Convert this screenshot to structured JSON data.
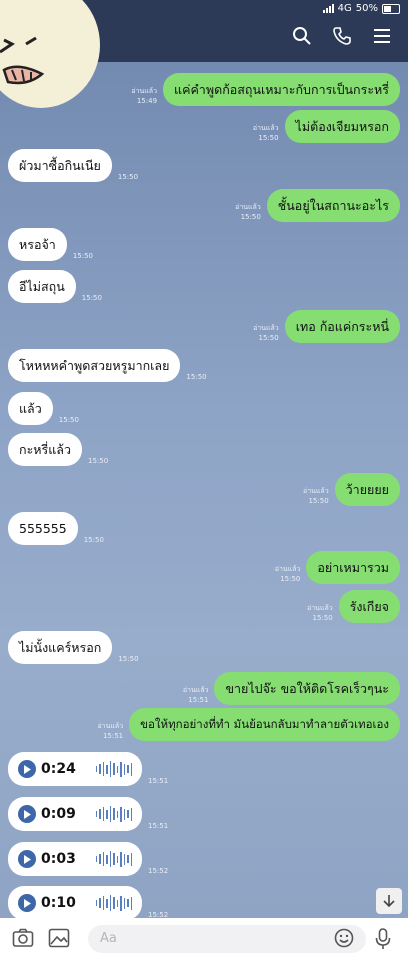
{
  "status": {
    "network": "4G",
    "battery": "50%"
  },
  "messages": [
    {
      "side": "me",
      "text": "แค่คำพูดก้อสถุนเหมาะกับการเป็นกระหรี่",
      "read": "อ่านแล้ว",
      "time": "15:49"
    },
    {
      "side": "me",
      "text": "ไม่ต้องเจียมหรอก",
      "read": "อ่านแล้ว",
      "time": "15:50"
    },
    {
      "side": "them",
      "text": "ผัวมาซื้อกินเนีย",
      "time": "15:50"
    },
    {
      "side": "me",
      "text": "ชั้นอยู่ในสถานะอะไร",
      "read": "อ่านแล้ว",
      "time": "15:50"
    },
    {
      "side": "them",
      "text": "หรอจ้า",
      "time": "15:50"
    },
    {
      "side": "them",
      "text": "อีไม่สถุน",
      "time": "15:50"
    },
    {
      "side": "me",
      "text": "เทอ ก้อแค่กระหนี่",
      "read": "อ่านแล้ว",
      "time": "15:50"
    },
    {
      "side": "them",
      "text": "โหหหหคำพูดสวยหรูมากเลย",
      "time": "15:50"
    },
    {
      "side": "them",
      "text": "แล้ว",
      "time": "15:50"
    },
    {
      "side": "them",
      "text": "กะหรี่แล้ว",
      "time": "15:50"
    },
    {
      "side": "me",
      "text": "ว้ายยยย",
      "read": "อ่านแล้ว",
      "time": "15:50"
    },
    {
      "side": "them",
      "text": "555555",
      "time": "15:50"
    },
    {
      "side": "me",
      "text": "อย่าเหมารวม",
      "read": "อ่านแล้ว",
      "time": "15:50"
    },
    {
      "side": "me",
      "text": "รังเกียจ",
      "read": "อ่านแล้ว",
      "time": "15:50"
    },
    {
      "side": "them",
      "text": "ไม่นั้งแคร์หรอก",
      "time": "15:50"
    },
    {
      "side": "me",
      "text": "ขายไปจ๊ะ ขอให้ติดโรคเร็วๆนะ",
      "read": "อ่านแล้ว",
      "time": "15:51"
    },
    {
      "side": "me",
      "text": "ขอให้ทุกอย่างที่ทำ มันย้อนกลับมาทำลายตัวเทอเอง",
      "read": "อ่านแล้ว",
      "time": "15:51"
    }
  ],
  "voice_messages": [
    {
      "duration": "0:24",
      "time": "15:51"
    },
    {
      "duration": "0:09",
      "time": "15:51"
    },
    {
      "duration": "0:03",
      "time": "15:52"
    },
    {
      "duration": "0:10",
      "time": "15:52"
    }
  ],
  "composer": {
    "placeholder": "Aa"
  },
  "icons": {
    "search": "search-icon",
    "call": "phone-icon",
    "menu": "menu-icon",
    "camera": "camera-icon",
    "image": "image-icon",
    "emoji": "emoji-icon",
    "mic": "mic-icon",
    "scroll": "arrow-down-icon"
  },
  "colors": {
    "header": "#2c3a57",
    "sent": "#86dd72",
    "received": "#ffffff",
    "play": "#3d67a8"
  }
}
